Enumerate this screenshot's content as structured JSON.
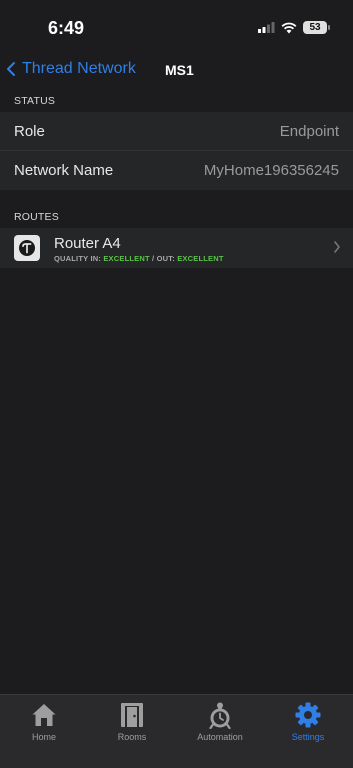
{
  "status_bar": {
    "time": "6:49",
    "battery": "53"
  },
  "nav": {
    "back_label": "Thread Network",
    "title": "MS1"
  },
  "status_section": {
    "header": "STATUS",
    "rows": [
      {
        "label": "Role",
        "value": "Endpoint"
      },
      {
        "label": "Network Name",
        "value": "MyHome196356245"
      }
    ]
  },
  "routes_section": {
    "header": "ROUTES",
    "router": {
      "name": "Router A4",
      "quality_in_label": "QUALITY IN:",
      "quality_in": "EXCELLENT",
      "separator": "/ OUT:",
      "quality_out": "EXCELLENT"
    }
  },
  "tabbar": {
    "tabs": [
      {
        "label": "Home",
        "icon": "home-icon"
      },
      {
        "label": "Rooms",
        "icon": "door-icon"
      },
      {
        "label": "Automation",
        "icon": "automation-clock-icon"
      },
      {
        "label": "Settings",
        "icon": "gear-icon",
        "active": true
      }
    ]
  },
  "colors": {
    "accent": "#2f7fe6",
    "good": "#59c247",
    "background": "#1c1c1e",
    "row": "#252628"
  }
}
